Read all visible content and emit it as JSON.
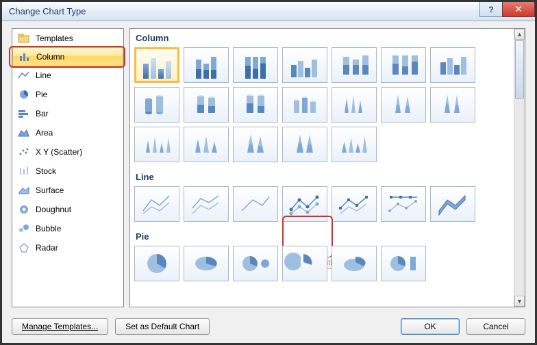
{
  "title": "Change Chart Type",
  "categories": [
    {
      "label": "Templates",
      "icon": "folder"
    },
    {
      "label": "Column",
      "icon": "column",
      "selected": true
    },
    {
      "label": "Line",
      "icon": "line"
    },
    {
      "label": "Pie",
      "icon": "pie"
    },
    {
      "label": "Bar",
      "icon": "bar"
    },
    {
      "label": "Area",
      "icon": "area"
    },
    {
      "label": "X Y (Scatter)",
      "icon": "scatter"
    },
    {
      "label": "Stock",
      "icon": "stock"
    },
    {
      "label": "Surface",
      "icon": "surface"
    },
    {
      "label": "Doughnut",
      "icon": "doughnut"
    },
    {
      "label": "Bubble",
      "icon": "bubble"
    },
    {
      "label": "Radar",
      "icon": "radar"
    }
  ],
  "sections": {
    "column": "Column",
    "line": "Line",
    "pie": "Pie"
  },
  "tooltip": "Line with Markers",
  "buttons": {
    "manage_templates": "Manage Templates...",
    "set_default": "Set as Default Chart",
    "ok": "OK",
    "cancel": "Cancel"
  }
}
